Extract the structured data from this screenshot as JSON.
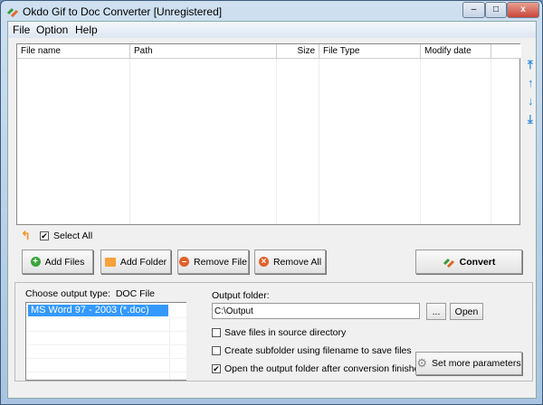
{
  "window": {
    "title": "Okdo Gif to Doc Converter [Unregistered]",
    "minimize": "–",
    "maximize": "□",
    "close": "x"
  },
  "menu": [
    "File",
    "Option",
    "Help"
  ],
  "table": {
    "columns": [
      "File name",
      "Path",
      "Size",
      "File Type",
      "Modify date"
    ],
    "rows": []
  },
  "select_all": {
    "label": "Select All",
    "checked": true
  },
  "buttons": {
    "add_files": "Add Files",
    "add_folder": "Add Folder",
    "remove_file": "Remove File",
    "remove_all": "Remove All",
    "convert": "Convert"
  },
  "output": {
    "type_label": "Choose output type:",
    "type_value": "DOC File",
    "formats": [
      "MS Word 97 - 2003 (*.doc)"
    ],
    "folder_label": "Output folder:",
    "folder_value": "C:\\Output",
    "browse": "...",
    "open": "Open",
    "options": [
      {
        "label": "Save files in source directory",
        "checked": false
      },
      {
        "label": "Create subfolder using filename to save files",
        "checked": false
      },
      {
        "label": "Open the output folder after conversion finished",
        "checked": true
      }
    ],
    "set_params": "Set more parameters"
  },
  "colors": {
    "selection": "#3399ff",
    "accent_orange": "#f39a2b",
    "close_red": "#c9473a"
  }
}
